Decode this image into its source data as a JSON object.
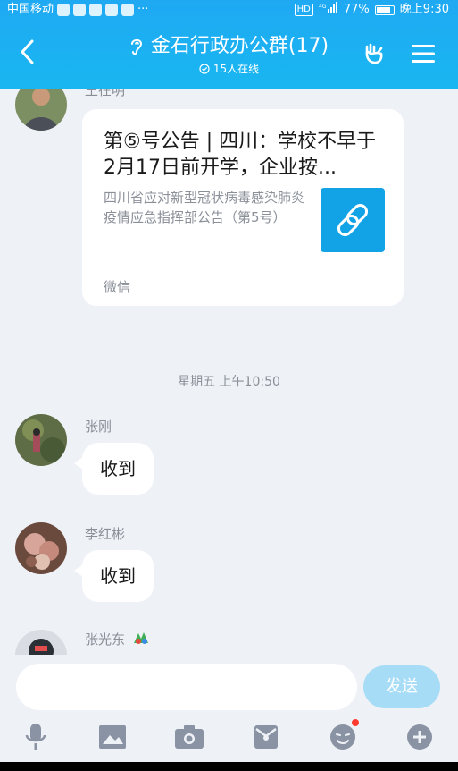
{
  "status_bar": {
    "carrier": "中国移动",
    "signal_label": "4G",
    "battery": "77%",
    "time": "晚上9:30"
  },
  "header": {
    "title": "金石行政办公群(17)",
    "online": "15人在线"
  },
  "messages": {
    "top_sender_partial": "王在明",
    "card": {
      "title": "第⑤号公告 | 四川：学校不早于2月17日前开学，企业按...",
      "description": "四川省应对新型冠状病毒感染肺炎疫情应急指挥部公告（第5号）",
      "source": "微信"
    },
    "time_separator": "星期五 上午10:50",
    "msg1": {
      "sender": "张刚",
      "text": "收到"
    },
    "msg2": {
      "sender": "李红彬",
      "text": "收到"
    },
    "msg3": {
      "sender": "张光东"
    }
  },
  "input": {
    "placeholder": "",
    "send_label": "发送"
  },
  "colors": {
    "header_blue": "#1fa9f3",
    "send_disabled": "#a7dcf7",
    "link_thumb": "#12a2e6"
  }
}
